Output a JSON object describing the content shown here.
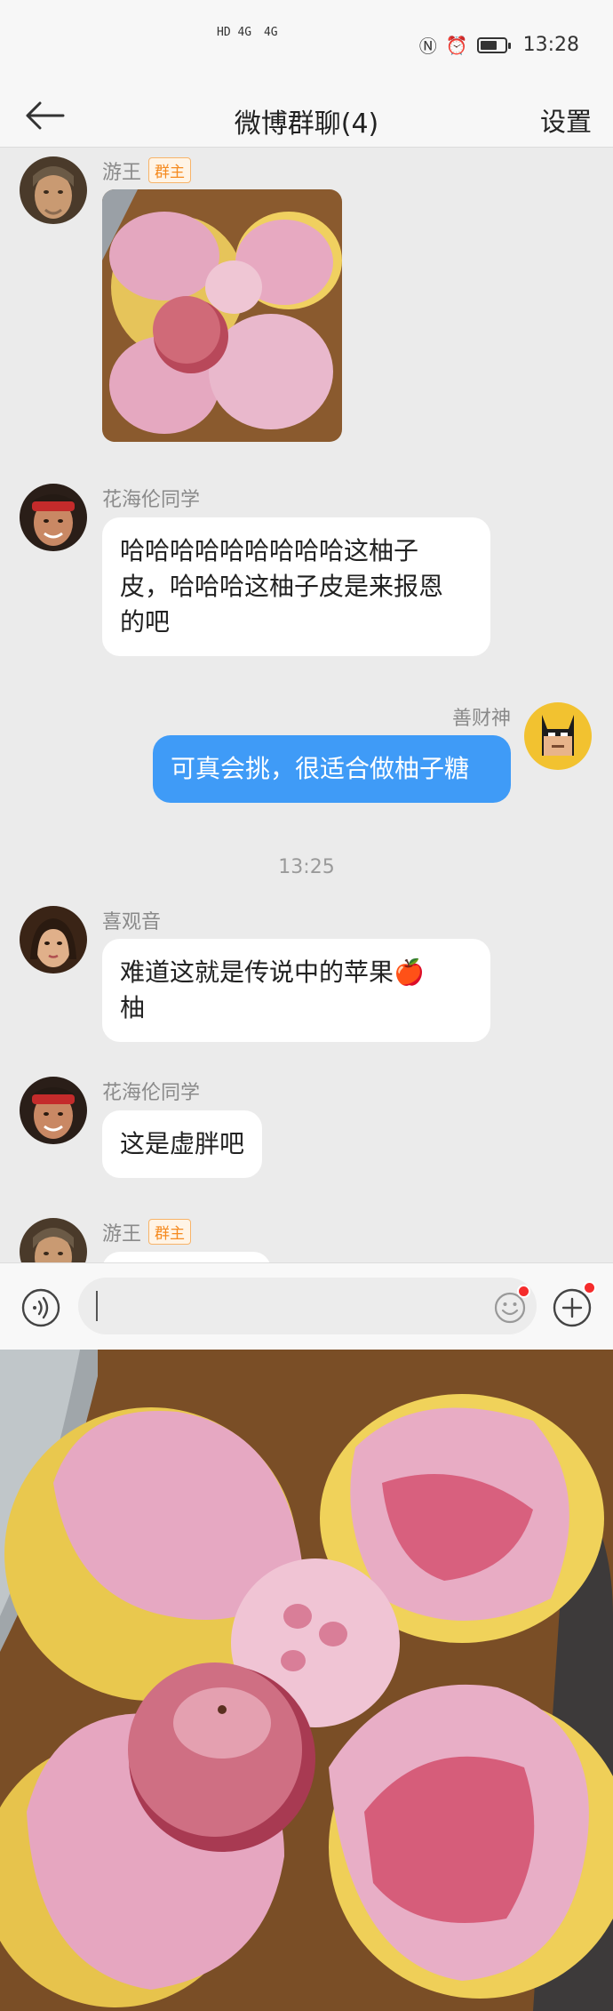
{
  "status_bar": {
    "network_left": "HD 4G",
    "network_right": "4G",
    "time": "13:28",
    "battery_level": 0.7
  },
  "nav": {
    "title": "微博群聊(4)",
    "settings": "设置"
  },
  "messages": [
    {
      "type": "image",
      "sender": "游王",
      "badge": "群主",
      "side": "left"
    },
    {
      "type": "text",
      "sender": "花海伦同学",
      "side": "left",
      "lines": [
        "哈哈哈哈哈哈哈哈哈这柚子",
        "皮，哈哈哈这柚子皮是来报恩",
        "的吧"
      ]
    },
    {
      "type": "text",
      "sender": "善财神",
      "side": "right",
      "lines": [
        "可真会挑，很适合做柚子糖"
      ]
    },
    {
      "type": "time",
      "text": "13:25"
    },
    {
      "type": "text",
      "sender": "喜观音",
      "side": "left",
      "lines": [
        "难道这就是传说中的苹果🍎",
        "柚"
      ]
    },
    {
      "type": "text",
      "sender": "花海伦同学",
      "side": "left",
      "lines": [
        "这是虚胖吧"
      ]
    },
    {
      "type": "text",
      "sender": "游王",
      "badge": "群主",
      "side": "left",
      "lines": []
    }
  ],
  "input": {
    "placeholder": "",
    "voice_icon": "voice-icon",
    "emoji_icon": "emoji-icon",
    "plus_icon": "plus-icon"
  },
  "colors": {
    "self_bubble": "#3f9bf7",
    "badge": "#f58a1f",
    "notification": "#f52c2c"
  }
}
